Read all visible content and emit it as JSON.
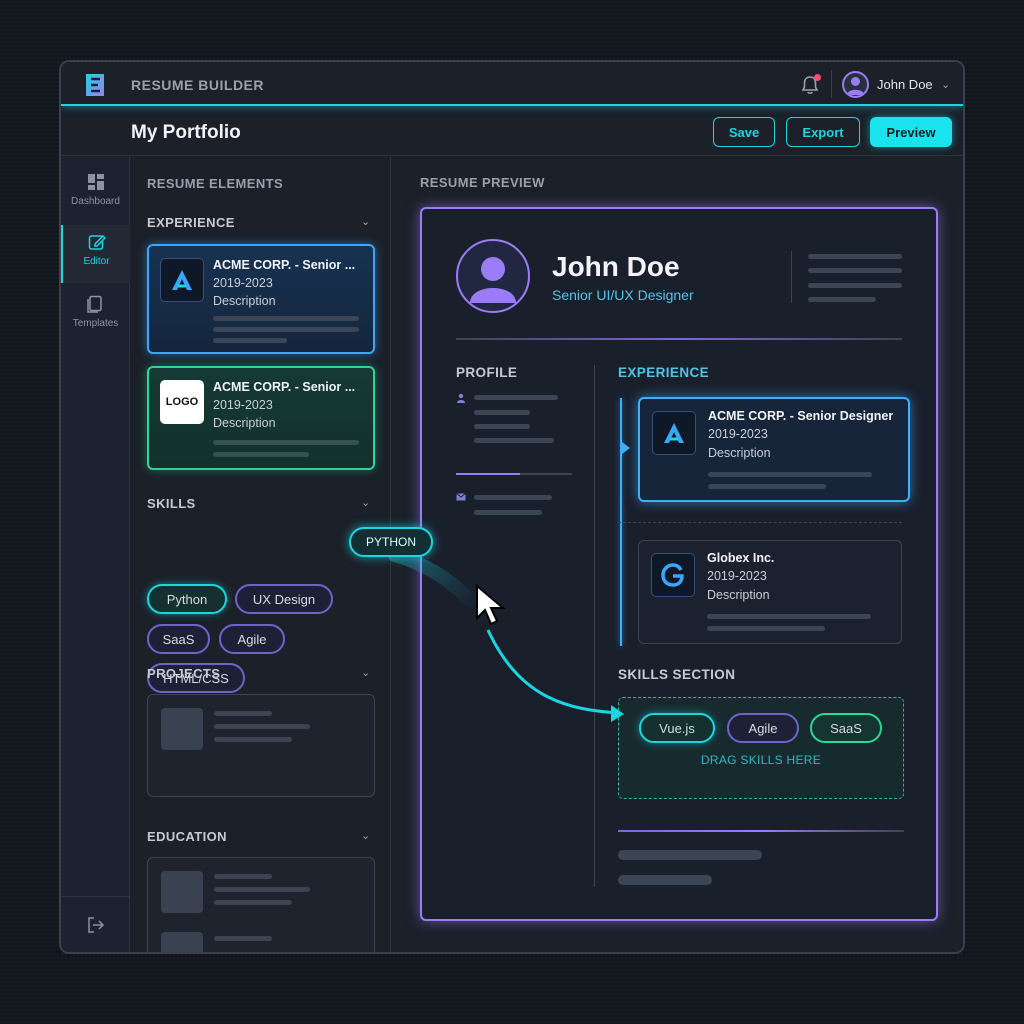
{
  "app": {
    "title": "RESUME BUILDER",
    "user_name": "John Doe"
  },
  "header": {
    "title": "My Portfolio",
    "save_label": "Save",
    "export_label": "Export",
    "preview_label": "Preview"
  },
  "rail": {
    "items": [
      {
        "label": "Dashboard",
        "icon": "dashboard-icon"
      },
      {
        "label": "Editor",
        "icon": "edit-icon"
      },
      {
        "label": "Templates",
        "icon": "templates-icon"
      }
    ]
  },
  "elements": {
    "heading": "RESUME ELEMENTS",
    "experience": {
      "heading": "EXPERIENCE",
      "cards": [
        {
          "title": "ACME CORP. - Senior ...",
          "years": "2019-2023",
          "desc": "Description",
          "thumb": "A"
        },
        {
          "title": "ACME CORP. - Senior ...",
          "years": "2019-2023",
          "desc": "Description",
          "thumb": "LOGO"
        }
      ]
    },
    "skills": {
      "heading": "SKILLS",
      "chips": [
        "Python",
        "UX Design",
        "SaaS",
        "Agile",
        "HTML/CSS"
      ]
    },
    "projects": {
      "heading": "PROJECTS"
    },
    "education": {
      "heading": "EDUCATION"
    }
  },
  "dragging_chip": "PYTHON",
  "preview": {
    "heading": "RESUME PREVIEW",
    "name": "John Doe",
    "role": "Senior UI/UX Designer",
    "profile_heading": "PROFILE",
    "experience_heading": "EXPERIENCE",
    "experience": [
      {
        "title": "ACME CORP. - Senior Designer",
        "years": "2019-2023",
        "desc": "Description",
        "thumb": "A"
      },
      {
        "title": "Globex Inc.",
        "years": "2019-2023",
        "desc": "Description",
        "thumb": "G"
      }
    ],
    "skills_heading": "SKILLS SECTION",
    "skills": [
      "Vue.js",
      "Agile",
      "SaaS"
    ],
    "drop_hint": "DRAG SKILLS HERE"
  },
  "colors": {
    "accent": "#19d6e0",
    "purple": "#9b7cf7",
    "blue": "#3aa6ff",
    "green": "#2bd69a"
  }
}
